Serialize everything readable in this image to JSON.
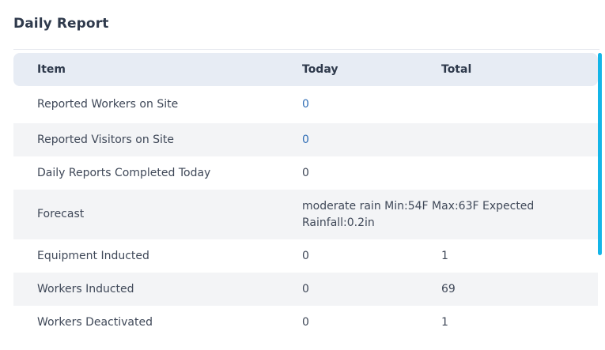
{
  "title": "Daily Report",
  "columns": {
    "item": "Item",
    "today": "Today",
    "total": "Total"
  },
  "rows": [
    {
      "item": "Reported Workers on Site",
      "today": "0",
      "total": ""
    },
    {
      "item": "Reported Visitors on Site",
      "today": "0",
      "total": ""
    },
    {
      "item": "Daily Reports Completed Today",
      "today": "0",
      "total": ""
    },
    {
      "item": "Forecast",
      "today": "moderate rain Min:54F Max:63F Expected Rainfall:0.2in",
      "total": ""
    },
    {
      "item": "Equipment Inducted",
      "today": "0",
      "total": "1"
    },
    {
      "item": "Workers Inducted",
      "today": "0",
      "total": "69"
    },
    {
      "item": "Workers Deactivated",
      "today": "0",
      "total": "1"
    }
  ],
  "colors": {
    "link": "#2f6db5",
    "scrollbar": "#13b5e8",
    "header_bg": "#e7ecf4",
    "alt_row_bg": "#f3f4f6"
  }
}
